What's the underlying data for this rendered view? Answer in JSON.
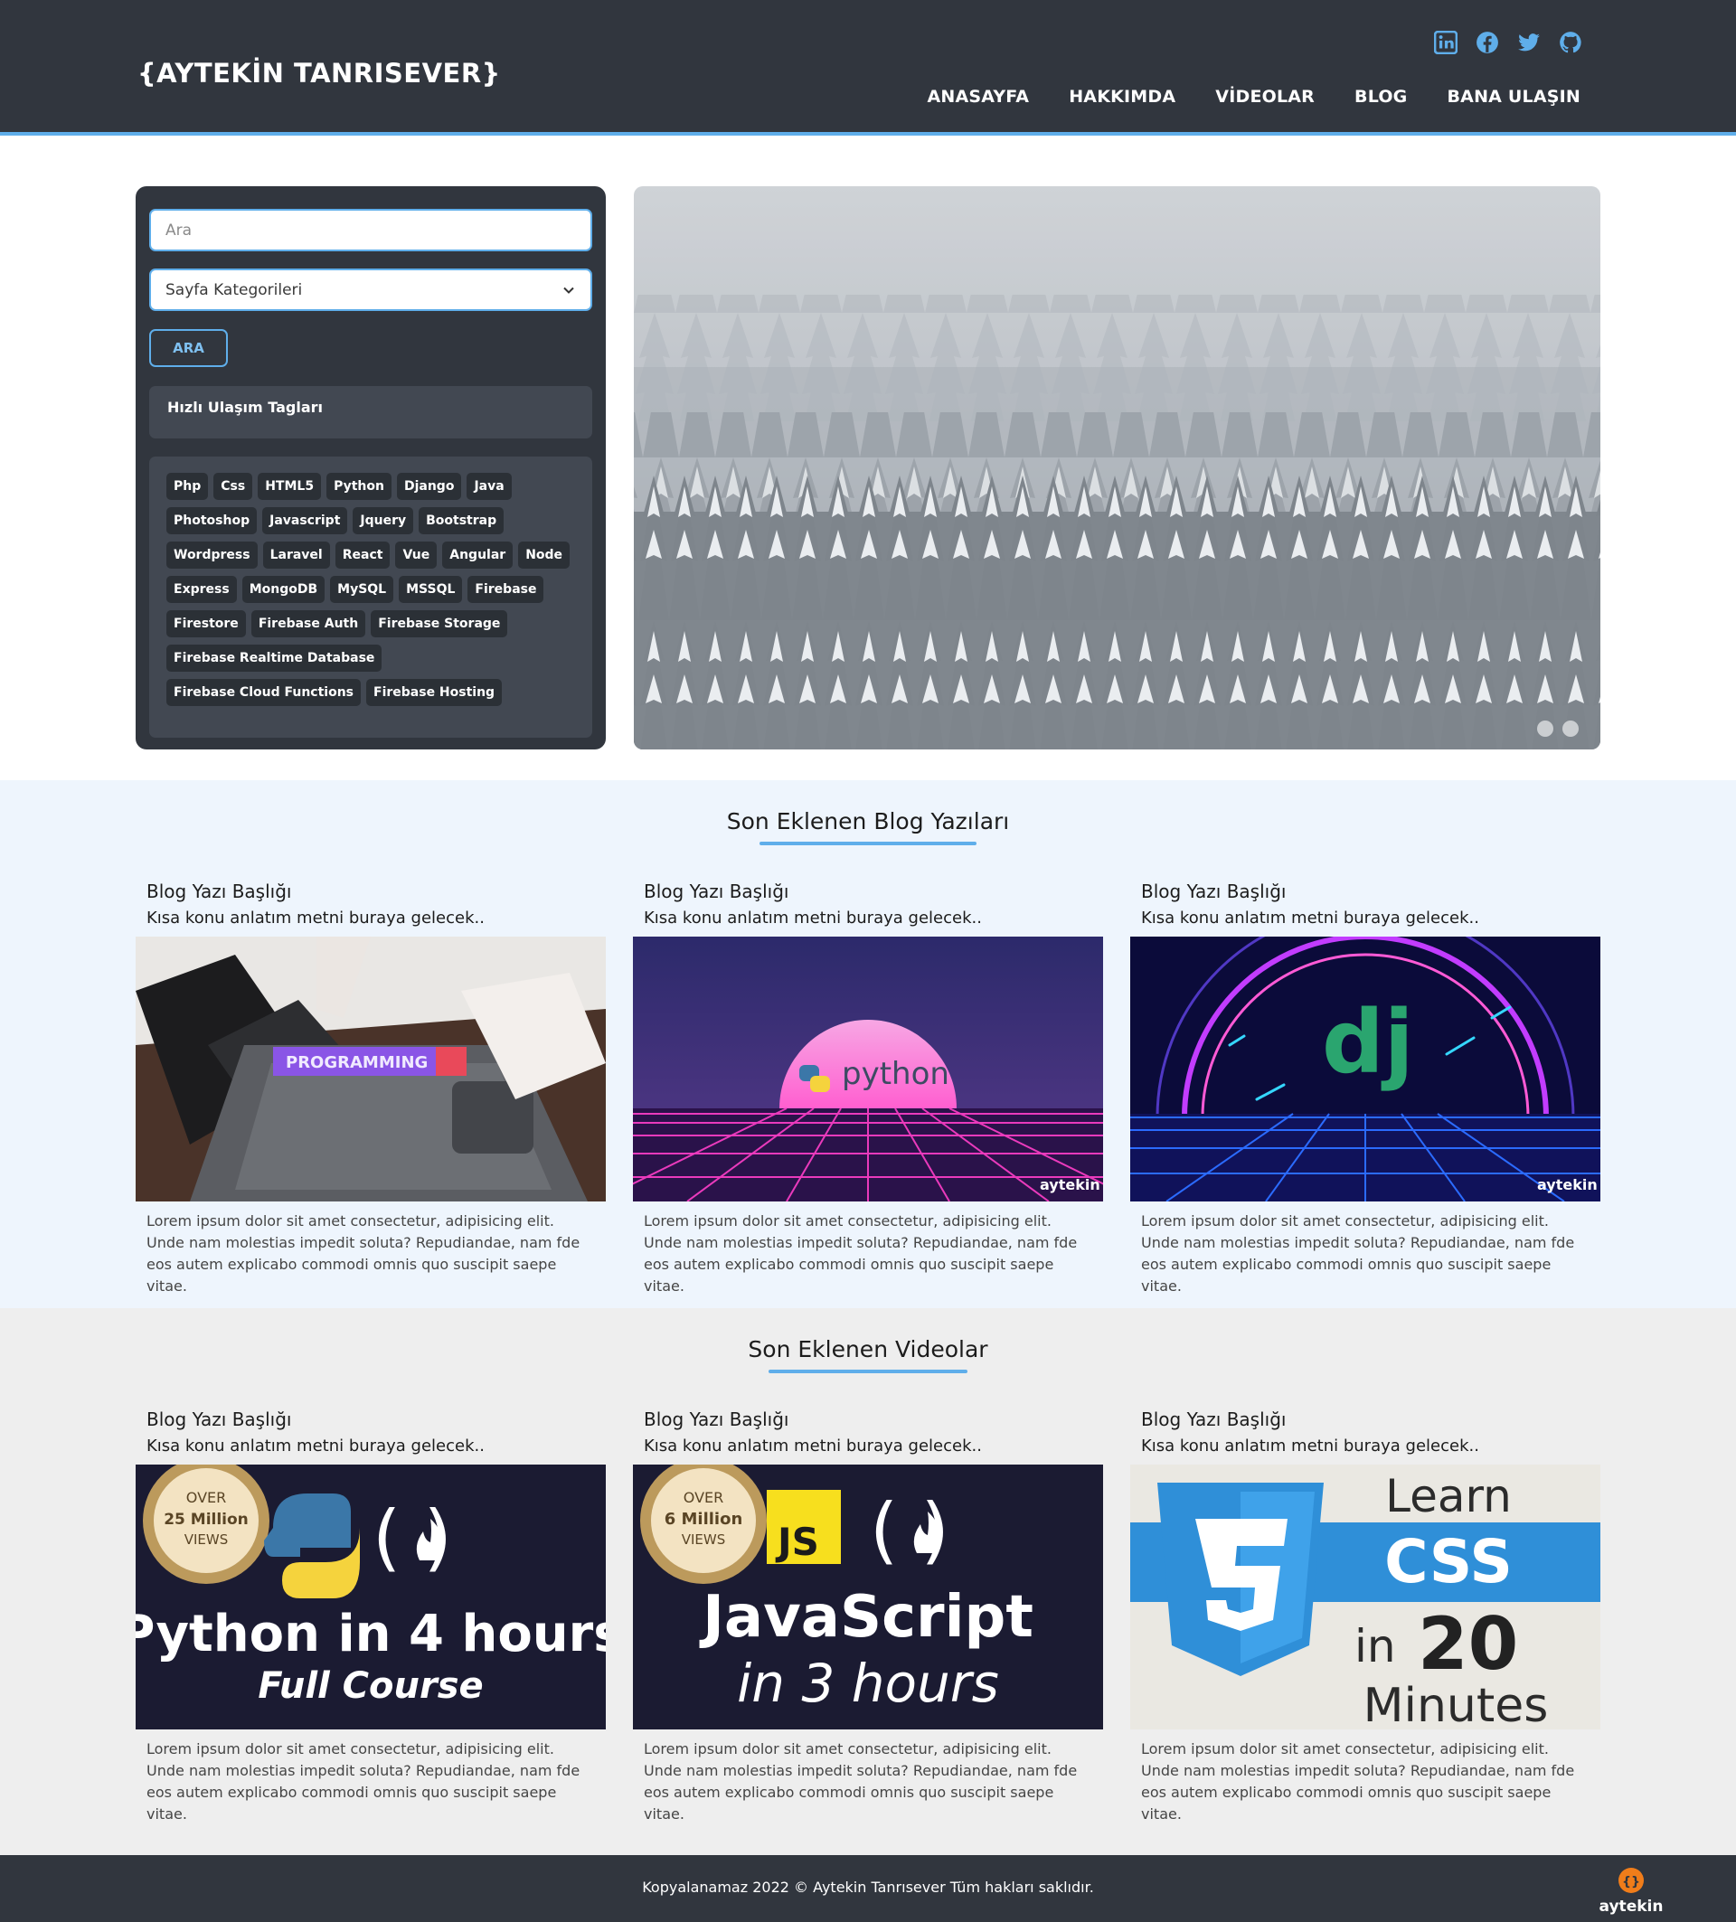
{
  "brand": {
    "logo_text": "{AYTEKİN TANRISEVER}"
  },
  "social": [
    {
      "icon": "linkedin-icon"
    },
    {
      "icon": "facebook-icon"
    },
    {
      "icon": "twitter-icon"
    },
    {
      "icon": "github-icon"
    }
  ],
  "nav": [
    {
      "label": "ANASAYFA"
    },
    {
      "label": "HAKKIMDA"
    },
    {
      "label": "VİDEOLAR"
    },
    {
      "label": "BLOG"
    },
    {
      "label": "BANA ULAŞIN"
    }
  ],
  "sidebar": {
    "search_placeholder": "Ara",
    "category_select": "Sayfa Kategorileri",
    "search_button": "ARA",
    "tags_heading": "Hızlı Ulaşım Tagları",
    "tags": [
      "Php",
      "Css",
      "HTML5",
      "Python",
      "Django",
      "Java",
      "Photoshop",
      "Javascript",
      "Jquery",
      "Bootstrap",
      "Wordpress",
      "Laravel",
      "React",
      "Vue",
      "Angular",
      "Node",
      "Express",
      "MongoDB",
      "MySQL",
      "MSSQL",
      "Firebase",
      "Firestore",
      "Firebase Auth",
      "Firebase Storage",
      "Firebase Realtime Database",
      "Firebase Cloud Functions",
      "Firebase Hosting"
    ]
  },
  "blog_section": {
    "title": "Son Eklenen Blog Yazıları",
    "cards": [
      {
        "title": "Blog Yazı Başlığı",
        "subtitle": "Kısa konu anlatım metni buraya gelecek..",
        "thumb_label": "PROGRAMMING",
        "text": "Lorem ipsum dolor sit amet consectetur, adipisicing elit. Unde nam molestias impedit soluta? Repudiandae, nam fde eos autem explicabo commodi omnis quo suscipit saepe vitae."
      },
      {
        "title": "Blog Yazı Başlığı",
        "subtitle": "Kısa konu anlatım metni buraya gelecek..",
        "thumb_label": "python",
        "watermark": "aytekin",
        "text": "Lorem ipsum dolor sit amet consectetur, adipisicing elit. Unde nam molestias impedit soluta? Repudiandae, nam fde eos autem explicabo commodi omnis quo suscipit saepe vitae."
      },
      {
        "title": "Blog Yazı Başlığı",
        "subtitle": "Kısa konu anlatım metni buraya gelecek..",
        "thumb_label": "dj",
        "watermark": "aytekin",
        "text": "Lorem ipsum dolor sit amet consectetur, adipisicing elit. Unde nam molestias impedit soluta? Repudiandae, nam fde eos autem explicabo commodi omnis quo suscipit saepe vitae."
      }
    ]
  },
  "video_section": {
    "title": "Son Eklenen Videolar",
    "cards": [
      {
        "title": "Blog Yazı Başlığı",
        "subtitle": "Kısa konu anlatım metni buraya gelecek..",
        "badge": [
          "OVER",
          "25 Million",
          "VIEWS"
        ],
        "line1": "Python in 4 hours",
        "line2": "Full Course",
        "text": "Lorem ipsum dolor sit amet consectetur, adipisicing elit. Unde nam molestias impedit soluta? Repudiandae, nam fde eos autem explicabo commodi omnis quo suscipit saepe vitae."
      },
      {
        "title": "Blog Yazı Başlığı",
        "subtitle": "Kısa konu anlatım metni buraya gelecek..",
        "badge": [
          "OVER",
          "6 Million",
          "VIEWS"
        ],
        "js_label": "JS",
        "line1": "JavaScript",
        "line2": "in 3 hours",
        "text": "Lorem ipsum dolor sit amet consectetur, adipisicing elit. Unde nam molestias impedit soluta? Repudiandae, nam fde eos autem explicabo commodi omnis quo suscipit saepe vitae."
      },
      {
        "title": "Blog Yazı Başlığı",
        "subtitle": "Kısa konu anlatım metni buraya gelecek..",
        "line1": "Learn",
        "line2": "CSS",
        "line3": "in",
        "line4": "20",
        "line5": "Minutes",
        "text": "Lorem ipsum dolor sit amet consectetur, adipisicing elit. Unde nam molestias impedit soluta? Repudiandae, nam fde eos autem explicabo commodi omnis quo suscipit saepe vitae."
      }
    ]
  },
  "footer": {
    "copyright": "Kopyalanamaz 2022 © Aytekin Tanrısever Tüm hakları saklıdır.",
    "logo_text": "aytekin"
  },
  "colors": {
    "header_bg": "#31363e",
    "accent": "#5faeea",
    "blog_bg": "#eef5fd",
    "video_bg": "#eeeeee"
  }
}
